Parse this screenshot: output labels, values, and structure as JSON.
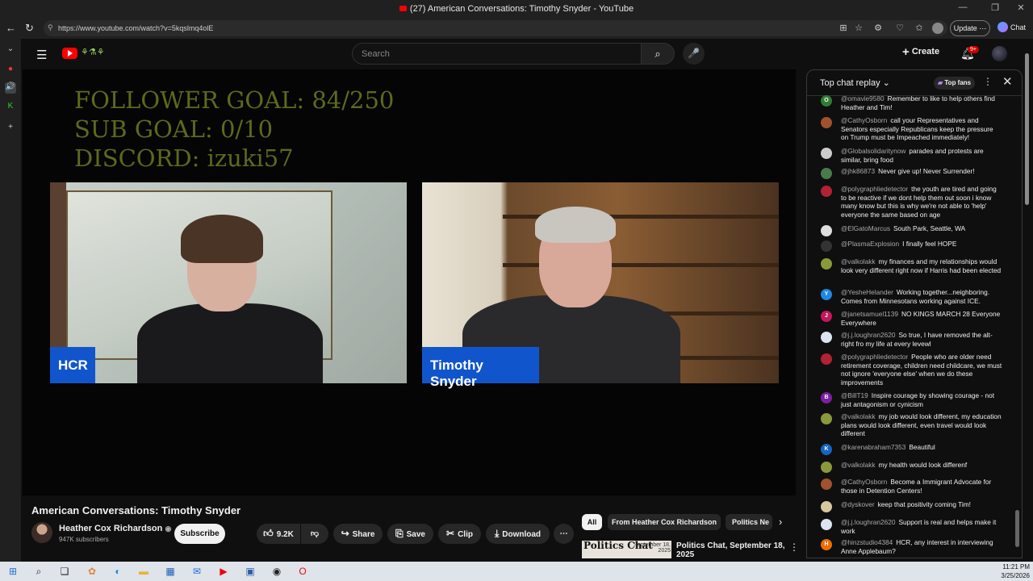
{
  "window": {
    "title": "(27) American Conversations: Timothy Snyder - YouTube"
  },
  "browser": {
    "url": "https://www.youtube.com/watch?v=5kqslmq4olE",
    "update_label": "Update",
    "chat_label": "Chat"
  },
  "youtube": {
    "search_placeholder": "Search",
    "create_label": "Create",
    "notif_count": "9+"
  },
  "video": {
    "overlay_lines": [
      "FOLLOWER GOAL:  84/250",
      "SUB GOAL: 0/10",
      "DISCORD: izuki57"
    ],
    "left_name": "HCR",
    "right_name": "Timothy Snyder",
    "title": "American Conversations: Timothy Snyder"
  },
  "channel": {
    "name": "Heather Cox Richardson",
    "subscribers": "947K subscribers",
    "subscribe_label": "Subscribe"
  },
  "actions": {
    "likes": "9.2K",
    "share": "Share",
    "save": "Save",
    "clip": "Clip",
    "download": "Download"
  },
  "chips": {
    "all": "All",
    "from": "From Heather Cox Richardson",
    "politics": "Politics Ne"
  },
  "recommendation": {
    "title": "Politics Chat, September 18,",
    "subtitle": "2025",
    "thumb_text": "Politics Chat",
    "thumb_date": "September 18, 2025"
  },
  "chat": {
    "title": "Top chat replay",
    "top_fans": "Top fans",
    "messages": [
      {
        "author": "@omavie9580",
        "text": "Remember to like to help others find Heather and Tim!",
        "initial": "O",
        "color": "#2e7d32"
      },
      {
        "author": "@CathyOsborn",
        "text": "call your Representatives and Senators especially Republicans keep the pressure on Trump must be Impeached immediately!",
        "initial": "",
        "color": "#a0522d"
      },
      {
        "author": "@Globalsolidaritynow",
        "text": "parades and protests are similar, bring food",
        "initial": "",
        "color": "#cccccc"
      },
      {
        "author": "@jhk86873",
        "text": "Never give up! Never Surrender!",
        "initial": "",
        "color": "#4a7a4a"
      },
      {
        "author": "@polygraphliedetector",
        "text": "the youth are tired and going to be reactive if we dont help them out soon i know many know but this is why we're not able to 'help' everyone the same based on age",
        "initial": "",
        "color": "#b22234"
      },
      {
        "author": "@ElGatoMarcus",
        "text": "South Park, Seattle, WA",
        "initial": "",
        "color": "#dddddd"
      },
      {
        "author": "@PlasmaExplosion",
        "text": "I finally feel HOPE",
        "initial": "",
        "color": "#333333"
      },
      {
        "author": "@valkolakk",
        "text": "my finances and my relationships would look very different right now if Harris had been elected",
        "initial": "",
        "color": "#8a9a3a"
      },
      {
        "author": "@YesheHelander",
        "text": "Working together...neighboring. Comes from Minnesotans working against ICE.",
        "initial": "Y",
        "color": "#1e88e5"
      },
      {
        "author": "@janetsamuel1139",
        "text": "NO KINGS MARCH 28 Everyone Everywhere",
        "initial": "J",
        "color": "#c2185b"
      },
      {
        "author": "@j.j.loughran2620",
        "text": "So true, I have removed the alt-right fro my life at every levewl",
        "initial": "",
        "color": "#dde4f0"
      },
      {
        "author": "@polygraphliedetector",
        "text": "People who are older need retirement coverage, children need childcare, we must not ignore 'everyone else' when we do these improvements",
        "initial": "",
        "color": "#b22234"
      },
      {
        "author": "@BillT19",
        "text": "Inspire courage by showing courage - not just antagonism or cynicism",
        "initial": "B",
        "color": "#7b1fa2"
      },
      {
        "author": "@valkolakk",
        "text": "my job would look different, my education plans would look different, even travel would look different",
        "initial": "",
        "color": "#8a9a3a"
      },
      {
        "author": "@karenabraham7353",
        "text": "Beautiful",
        "initial": "K",
        "color": "#1565c0"
      },
      {
        "author": "@valkolakk",
        "text": "my health would look differenf",
        "initial": "",
        "color": "#8a9a3a"
      },
      {
        "author": "@CathyOsborn",
        "text": "Become a Immigrant Advocate for those in Detention Centers!",
        "initial": "",
        "color": "#a0522d"
      },
      {
        "author": "@dyskover",
        "text": "keep that positivity coming Tim!",
        "initial": "",
        "color": "#d8c8a0"
      },
      {
        "author": "@j.j.loughran2620",
        "text": "Support is real and helps make it work",
        "initial": "",
        "color": "#dde4f0"
      },
      {
        "author": "@hinzstudio4384",
        "text": "HCR, any interest in interviewing Anne Applebaum?",
        "initial": "H",
        "color": "#ef6c00"
      }
    ]
  },
  "clock": {
    "time": "11:21 PM",
    "date": "3/25/2026"
  }
}
